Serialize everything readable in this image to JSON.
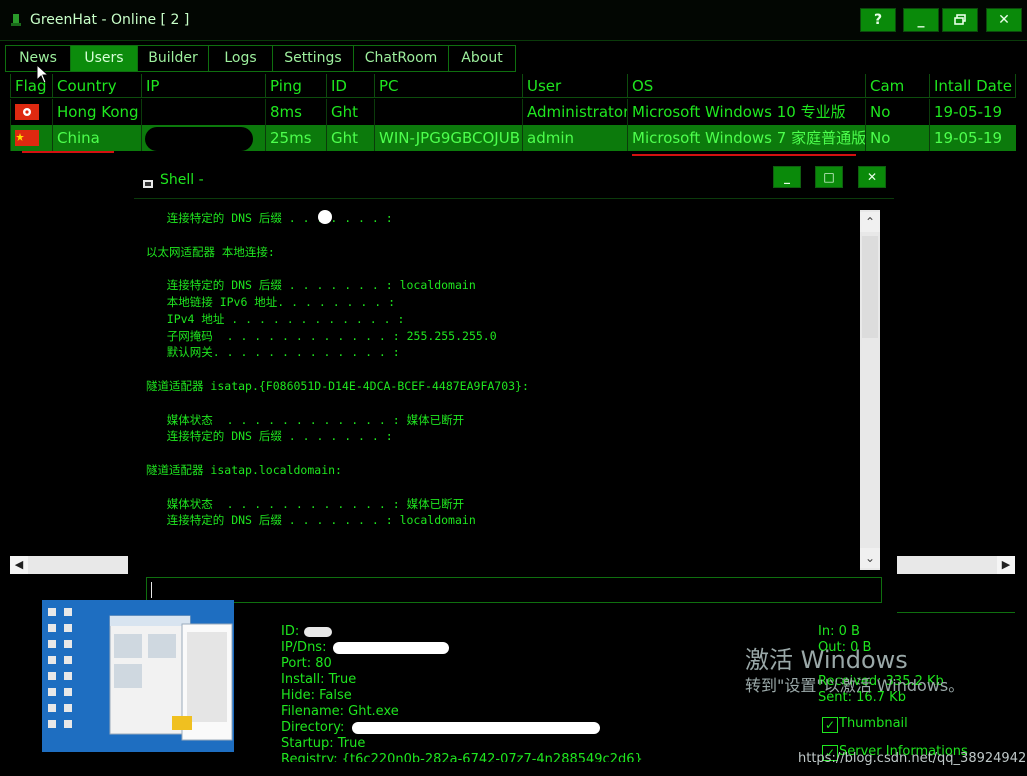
{
  "window": {
    "title": "GreenHat - Online [ 2 ]",
    "buttons": {
      "help": "?",
      "minimize": "_",
      "restore": "🗗",
      "close": "✕"
    }
  },
  "tabs": [
    "News",
    "Users",
    "Builder",
    "Logs",
    "Settings",
    "ChatRoom",
    "About"
  ],
  "active_tab": "Users",
  "table": {
    "headers": [
      "Flag",
      "Country",
      "IP",
      "Ping",
      "ID",
      "PC",
      "User",
      "OS",
      "Cam",
      "Intall Date"
    ],
    "rows": [
      {
        "flag": "hong-kong-flag",
        "country": "Hong Kong",
        "ip": "",
        "ping": "8ms",
        "id": "Ght",
        "pc": "",
        "user": "Administrator",
        "os": "Microsoft Windows 10 专业版",
        "cam": "No",
        "date": "19-05-19"
      },
      {
        "flag": "china-flag",
        "country": "China",
        "ip": "",
        "ping": "25ms",
        "id": "Ght",
        "pc": "WIN-JPG9GBCOJUB",
        "user": "admin",
        "os": "Microsoft Windows 7 家庭普通版",
        "cam": "No",
        "date": "19-05-19"
      }
    ]
  },
  "shell": {
    "title": "Shell -",
    "buttons": {
      "minimize": "_",
      "maximize": "□",
      "close": "✕"
    },
    "output": "   连接特定的 DNS 后缀 . . . . . . . :\n\n以太网适配器 本地连接:\n\n   连接特定的 DNS 后缀 . . . . . . . : localdomain\n   本地链接 IPv6 地址. . . . . . . . :\n   IPv4 地址 . . . . . . . . . . . . :\n   子网掩码  . . . . . . . . . . . . : 255.255.255.0\n   默认网关. . . . . . . . . . . . . :\n\n隧道适配器 isatap.{F086051D-D14E-4DCA-BCEF-4487EA9FA703}:\n\n   媒体状态  . . . . . . . . . . . . : 媒体已断开\n   连接特定的 DNS 后缀 . . . . . . . :\n\n隧道适配器 isatap.localdomain:\n\n   媒体状态  . . . . . . . . . . . . : 媒体已断开\n   连接特定的 DNS 后缀 . . . . . . . : localdomain",
    "input_value": ""
  },
  "info": {
    "id_label": "ID:",
    "ipdns_label": "IP/Dns:",
    "port": "Port: 80",
    "install": "Install: True",
    "hide": "Hide: False",
    "filename": "Filename: Ght.exe",
    "directory_label": "Directory:",
    "startup": "Startup: True",
    "registry": "Registry: {t6c220n0b-282a-6742-07z7-4n288549c2d6}"
  },
  "stats": {
    "in": "In: 0 B",
    "out": "Out: 0 B",
    "received": "Received: 335.2 Kb",
    "sent": "Sent: 16.7 Kb"
  },
  "options": {
    "thumbnail": "Thumbnail",
    "server_info": "Server Informations"
  },
  "watermark": {
    "line1": "激活 Windows",
    "line2": "转到\"设置\"以激活 Windows。"
  },
  "source_watermark": "https://blog.csdn.net/qq_38924942",
  "colors": {
    "accent": "#0c8c0c",
    "text": "#1fe61f",
    "background": "#000000",
    "annotation": "#d41010"
  }
}
